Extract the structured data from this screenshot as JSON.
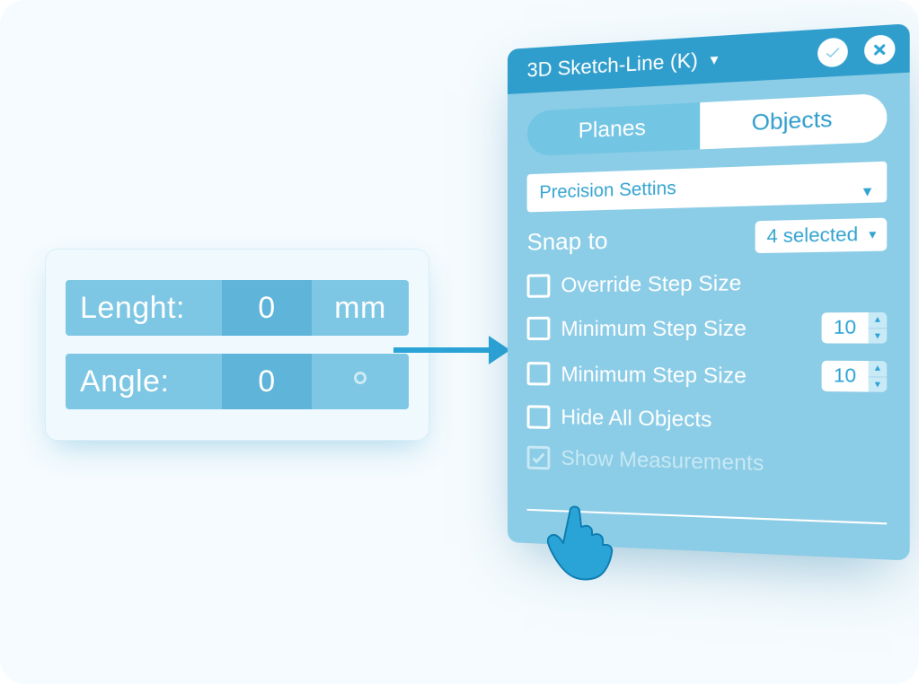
{
  "measurements": {
    "length": {
      "label": "Lenght:",
      "value": "0",
      "unit": "mm"
    },
    "angle": {
      "label": "Angle:",
      "value": "0"
    }
  },
  "panel": {
    "title": "3D Sketch-Line (K)",
    "tabs": {
      "planes": "Planes",
      "objects": "Objects"
    },
    "precision_label": "Precision Settins",
    "snap_label": "Snap to",
    "snap_selected": "4 selected",
    "options": {
      "override": "Override Step Size",
      "min1": "Minimum Step Size",
      "min2": "Minimum Step Size",
      "hide": "Hide All Objects",
      "showm": "Show Measurements"
    },
    "spin1": "10",
    "spin2": "10"
  }
}
